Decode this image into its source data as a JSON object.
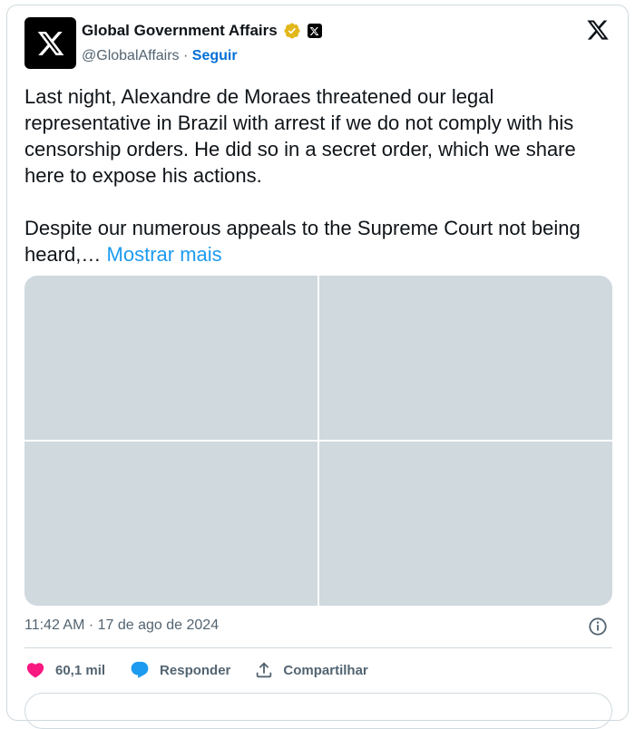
{
  "author": {
    "name": "Global Government Affairs",
    "handle": "@GlobalAffairs",
    "separator": "·",
    "follow_label": "Seguir"
  },
  "tweet": {
    "paragraph1": "Last night, Alexandre de Moraes threatened our legal representative in Brazil with arrest if we do not comply with his censorship orders. He did so in a secret order, which we share here to expose his actions.",
    "paragraph2": "Despite our numerous appeals to the Supreme Court not being heard,…",
    "show_more": "Mostrar mais",
    "media_count": 4
  },
  "meta": {
    "timestamp": "11:42 AM · 17 de ago de 2024"
  },
  "actions": {
    "likes": "60,1 mil",
    "reply_label": "Responder",
    "share_label": "Compartilhar"
  },
  "icons": {
    "avatar": "x-logo-icon",
    "verified": "verified-badge-icon",
    "affiliate": "x-affiliate-icon",
    "brand": "x-logo-icon",
    "info": "info-icon",
    "like": "heart-icon",
    "reply": "reply-bubble-icon",
    "share": "share-icon"
  },
  "colors": {
    "accent": "#1d9bf0",
    "follow": "#006fd6",
    "like": "#f91880",
    "verified": "#e2b719",
    "muted": "#536471",
    "media_placeholder": "#cfd9de"
  }
}
